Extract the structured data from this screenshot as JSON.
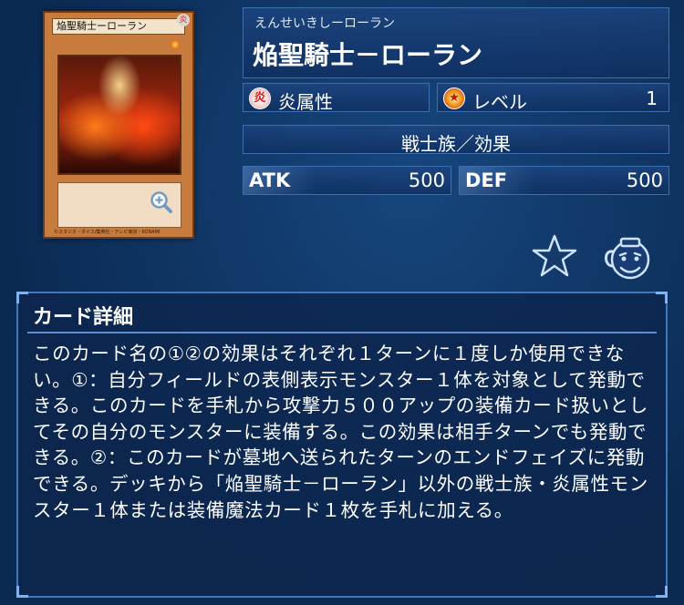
{
  "card": {
    "mini_name": "焔聖騎士ーローラン",
    "mini_attribute": "炎",
    "footer": "©スタジオ・ダイス/集英社・テレビ東京・KONAMI"
  },
  "name_panel": {
    "furigana": "えんせいきしーローラン",
    "name": "焔聖騎士－ローラン"
  },
  "attribute": {
    "icon": "fire-attribute-icon",
    "glyph": "炎",
    "label": "炎属性"
  },
  "level": {
    "icon": "level-star-icon",
    "label": "レベル",
    "value": "1"
  },
  "type": {
    "label": "戦士族／効果"
  },
  "stats": {
    "atk_label": "ATK",
    "atk_value": "500",
    "def_label": "DEF",
    "def_value": "500"
  },
  "actions": {
    "favorite_icon": "star-icon",
    "pot_icon": "pot-icon"
  },
  "detail": {
    "title": "カード詳細",
    "text": "このカード名の①②の効果はそれぞれ１ターンに１度しか使用できない。①：自分フィールドの表側表示モンスター１体を対象として発動できる。このカードを手札から攻撃力５００アップの装備カード扱いとしてその自分のモンスターに装備する。この効果は相手ターンでも発動できる。②：このカードが墓地へ送られたターンのエンドフェイズに発動できる。デッキから「焔聖騎士－ローラン」以外の戦士族・炎属性モンスター１体または装備魔法カード１枚を手札に加える。"
  },
  "colors": {
    "background": "#0b2a52",
    "panel_border": "#3d6fae",
    "accent": "#5b8fd3"
  }
}
